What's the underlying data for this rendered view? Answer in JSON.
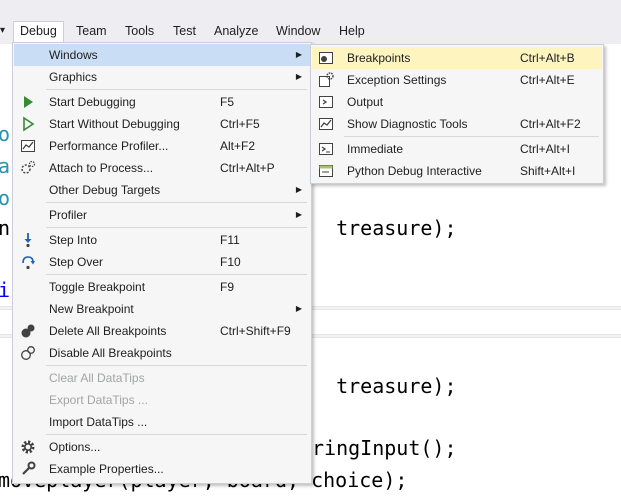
{
  "menubar": {
    "items": [
      "Debug",
      "Team",
      "Tools",
      "Test",
      "Analyze",
      "Window",
      "Help"
    ]
  },
  "editor": {
    "lines": [
      {
        "text": "o"
      },
      {
        "text": "a"
      },
      {
        "text": "o"
      },
      {
        "text": "n",
        "tail": "  treasure);"
      },
      {
        "text": "i"
      },
      {
        "tail": "  treasure);"
      },
      {
        "tail": "ringInput();"
      },
      {
        "text": "moveplayer(player, board, choice);"
      }
    ]
  },
  "debug_menu": {
    "items": [
      {
        "label": "Windows",
        "icon": "none",
        "submenu": true,
        "highlighted": true
      },
      {
        "label": "Graphics",
        "icon": "none",
        "submenu": true
      },
      {
        "label": "Start Debugging",
        "shortcut": "F5",
        "icon": "play-icon"
      },
      {
        "label": "Start Without Debugging",
        "shortcut": "Ctrl+F5",
        "icon": "play-outline-icon"
      },
      {
        "label": "Performance Profiler...",
        "shortcut": "Alt+F2",
        "icon": "profiler-icon"
      },
      {
        "label": "Attach to Process...",
        "shortcut": "Ctrl+Alt+P",
        "icon": "attach-icon"
      },
      {
        "label": "Other Debug Targets",
        "icon": "none",
        "submenu": true
      },
      {
        "label": "Profiler",
        "icon": "none",
        "submenu": true
      },
      {
        "label": "Step Into",
        "shortcut": "F11",
        "icon": "step-into-icon"
      },
      {
        "label": "Step Over",
        "shortcut": "F10",
        "icon": "step-over-icon"
      },
      {
        "label": "Toggle Breakpoint",
        "shortcut": "F9",
        "icon": "none"
      },
      {
        "label": "New Breakpoint",
        "icon": "none",
        "submenu": true
      },
      {
        "label": "Delete All Breakpoints",
        "shortcut": "Ctrl+Shift+F9",
        "icon": "delete-breakpoints-icon"
      },
      {
        "label": "Disable All Breakpoints",
        "icon": "disable-breakpoints-icon"
      },
      {
        "label": "Clear All DataTips",
        "icon": "none",
        "disabled": true
      },
      {
        "label": "Export DataTips ...",
        "icon": "none",
        "disabled": true
      },
      {
        "label": "Import DataTips ...",
        "icon": "none"
      },
      {
        "label": "Options...",
        "icon": "gear-icon"
      },
      {
        "label": "Example Properties...",
        "icon": "wrench-icon"
      }
    ]
  },
  "windows_submenu": {
    "items": [
      {
        "label": "Breakpoints",
        "shortcut": "Ctrl+Alt+B",
        "icon": "breakpoints-window-icon",
        "highlighted": true
      },
      {
        "label": "Exception Settings",
        "shortcut": "Ctrl+Alt+E",
        "icon": "exception-settings-icon"
      },
      {
        "label": "Output",
        "icon": "output-icon"
      },
      {
        "label": "Show Diagnostic Tools",
        "shortcut": "Ctrl+Alt+F2",
        "icon": "diagnostic-tools-icon"
      },
      {
        "label": "Immediate",
        "shortcut": "Ctrl+Alt+I",
        "icon": "immediate-icon"
      },
      {
        "label": "Python Debug Interactive",
        "shortcut": "Shift+Alt+I",
        "icon": "python-interactive-icon"
      }
    ]
  },
  "colors": {
    "highlight_yellow": "#fdf4bf",
    "highlight_blue": "#c9def5",
    "play_green": "#388a34",
    "menubar_bg": "#eeeef2"
  }
}
